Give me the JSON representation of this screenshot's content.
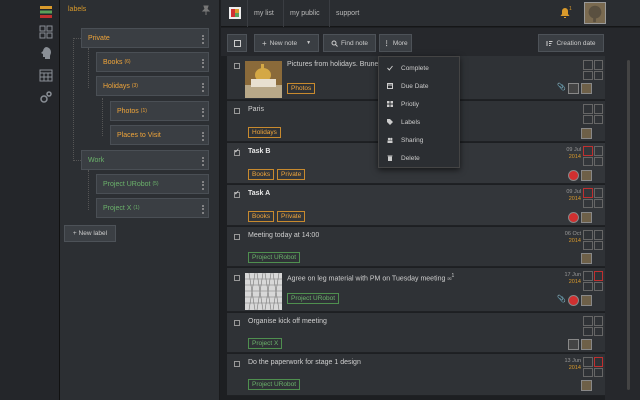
{
  "labels_panel": {
    "title": "labels",
    "items": [
      {
        "label": "Private",
        "count": ""
      },
      {
        "label": "Books",
        "count": "(6)"
      },
      {
        "label": "Holidays",
        "count": "(3)"
      },
      {
        "label": "Photos",
        "count": "(1)"
      },
      {
        "label": "Places to Visit",
        "count": ""
      },
      {
        "label": "Work",
        "count": ""
      },
      {
        "label": "Project URobot",
        "count": "(5)"
      },
      {
        "label": "Project X",
        "count": "(1)"
      }
    ],
    "new_label": "+ New label"
  },
  "nav": {
    "tabs": [
      "my list",
      "my public",
      "support"
    ],
    "notification_count": "1"
  },
  "toolbar": {
    "new_note": "New note",
    "find_note": "Find note",
    "more": "More",
    "sort": "Creation date"
  },
  "more_menu": {
    "items": [
      "Complete",
      "Due Date",
      "Priotiy",
      "Labels",
      "Sharing",
      "Delete"
    ]
  },
  "notes": [
    {
      "title": "Pictures from holidays. Brunei",
      "tags": [
        "Photos"
      ],
      "date": "",
      "year": ""
    },
    {
      "title": "Paris",
      "tags": [
        "Holidays"
      ],
      "date": "",
      "year": ""
    },
    {
      "title": "Task B",
      "tags": [
        "Books",
        "Private"
      ],
      "date": "09 Jul",
      "year": "2014"
    },
    {
      "title": "Task A",
      "tags": [
        "Books",
        "Private"
      ],
      "date": "09 Jul",
      "year": "2014"
    },
    {
      "title": "Meeting today at 14:00",
      "tags": [
        "Project URobot"
      ],
      "date": "06 Oct",
      "year": "2014"
    },
    {
      "title": "Agree on leg material with PM on Tuesday meeting",
      "comments": "1",
      "tags": [
        "Project URobot"
      ],
      "date": "17 Jun",
      "year": "2014"
    },
    {
      "title": "Organise kick off meeting",
      "tags": [
        "Project X"
      ],
      "date": "",
      "year": ""
    },
    {
      "title": "Do the paperwork for stage 1 design",
      "tags": [
        "Project URobot"
      ],
      "date": "13 Jun",
      "year": "2014"
    }
  ],
  "colors": {
    "accent": "#d99a2b",
    "green_label": "#6bb26b",
    "orange_label": "#f0a53a"
  }
}
